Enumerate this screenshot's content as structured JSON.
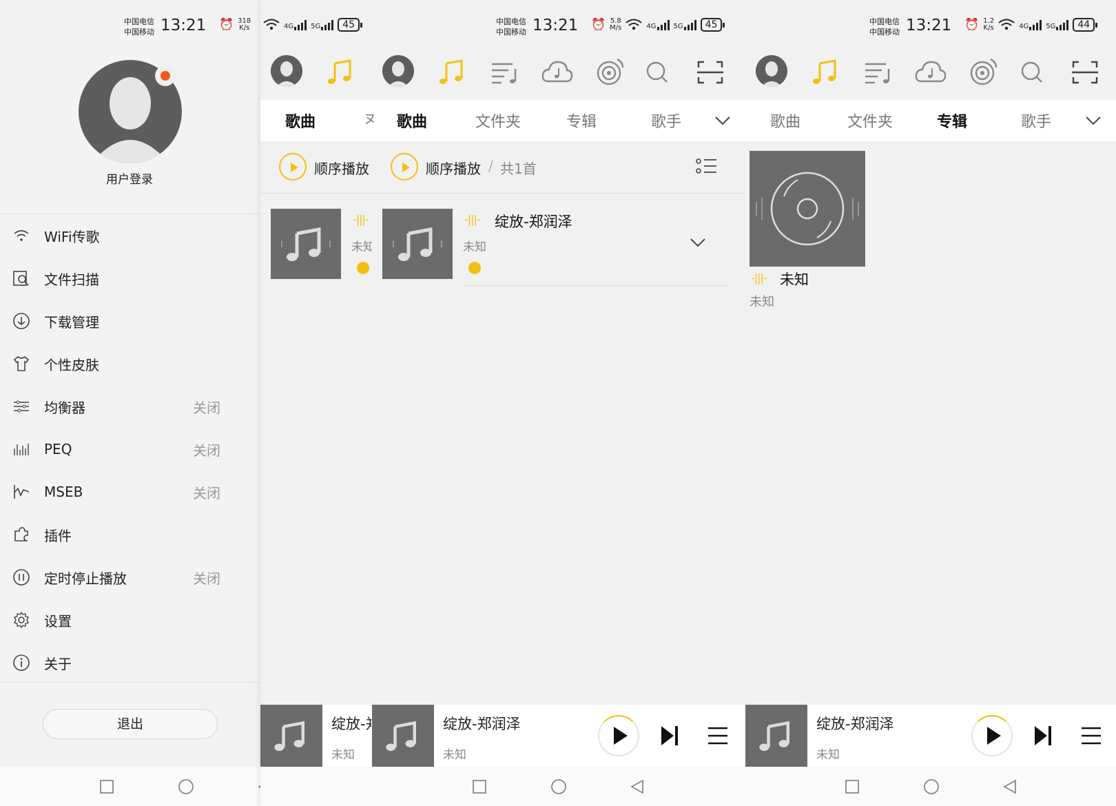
{
  "status_bars": [
    {
      "carrier1": "中国电信",
      "carrier2": "中国移动",
      "time": "13:21",
      "speed_value": "318",
      "speed_unit": "K/s",
      "sig1": "4G",
      "sig2": "5G",
      "battery": "45"
    },
    {
      "carrier1": "中国电信",
      "carrier2": "中国移动",
      "time": "13:21",
      "speed_value": "5.8",
      "speed_unit": "M/s",
      "sig1": "4G",
      "sig2": "5G",
      "battery": "45"
    },
    {
      "carrier1": "中国电信",
      "carrier2": "中国移动",
      "time": "13:21",
      "speed_value": "1.2",
      "speed_unit": "K/s",
      "sig1": "4G",
      "sig2": "5G",
      "battery": "44"
    }
  ],
  "sidebar": {
    "login_label": "用户登录",
    "items": [
      {
        "label": "WiFi传歌",
        "icon": "wifi-icon",
        "value": ""
      },
      {
        "label": "文件扫描",
        "icon": "scan-file-icon",
        "value": ""
      },
      {
        "label": "下载管理",
        "icon": "download-icon",
        "value": ""
      },
      {
        "label": "个性皮肤",
        "icon": "shirt-icon",
        "value": ""
      },
      {
        "label": "均衡器",
        "icon": "equalizer-icon",
        "value": "关闭"
      },
      {
        "label": "PEQ",
        "icon": "peq-icon",
        "value": "关闭"
      },
      {
        "label": "MSEB",
        "icon": "mseb-icon",
        "value": "关闭"
      },
      {
        "label": "插件",
        "icon": "plugin-icon",
        "value": ""
      },
      {
        "label": "定时停止播放",
        "icon": "timer-icon",
        "value": "关闭"
      },
      {
        "label": "设置",
        "icon": "gear-icon",
        "value": ""
      },
      {
        "label": "关于",
        "icon": "info-icon",
        "value": ""
      }
    ],
    "exit_label": "退出"
  },
  "tabs": {
    "songs": "歌曲",
    "folders": "文件夹",
    "albums": "专辑",
    "artists": "歌手"
  },
  "songs_view": {
    "play_order_label": "顺序播放",
    "separator": "/",
    "count_label": "共1首",
    "song_title": "绽放-郑润泽",
    "song_artist": "未知"
  },
  "album_view": {
    "album_title": "未知",
    "album_artist": "未知"
  },
  "now_playing": {
    "title": "绽放-郑润泽",
    "artist": "未知"
  },
  "colors": {
    "accent": "#f2c012",
    "thumb": "#6b6b6b"
  }
}
